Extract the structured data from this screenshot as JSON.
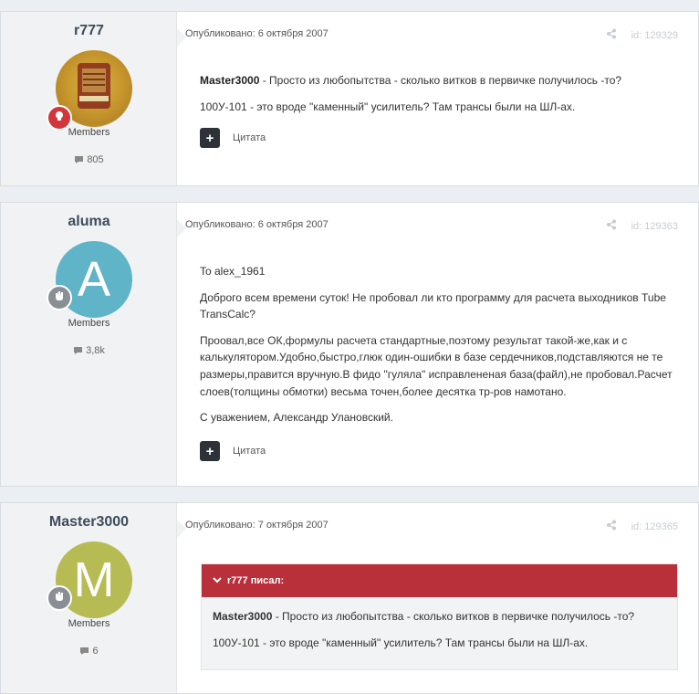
{
  "posts": [
    {
      "author": "r777",
      "group": "Members",
      "count": "805",
      "meta": "Опубликовано: 6 октября 2007",
      "id": "id: 129329",
      "content_bold": "Master3000",
      "content_rest": " - Просто из любопытства - сколько витков в первичке получилось -то?",
      "content_line2": "100У-101 - это вроде \"каменный\" усилитель? Там трансы были на ШЛ-ах.",
      "quote_label": "Цитата"
    },
    {
      "author": "aluma",
      "avatar_letter": "A",
      "group": "Members",
      "count": "3,8k",
      "meta": "Опубликовано: 6 октября 2007",
      "id": "id: 129363",
      "paragraphs": [
        "To alex_1961",
        "Доброго всем времени суток! Не пробовал ли кто программу для расчета выходников Tube TransCalc?",
        "Проовал,все ОК,формулы расчета стандартные,поэтому результат такой-же,как и с калькулятором.Удобно,быстро,глюк один-ошибки в базе сердечников,подставляются не те размеры,правится вручную.В фидо \"гуляла\" исправлененая база(файл),не пробовал.Расчет слоев(толщины обмотки) весьма точен,более десятка тр-ров намотано.",
        "С уважением, Александр Улановский."
      ],
      "quote_label": "Цитата"
    },
    {
      "author": "Master3000",
      "avatar_letter": "M",
      "group": "Members",
      "count": "6",
      "meta": "Опубликовано: 7 октября 2007",
      "id": "id: 129365",
      "quote_head": "r777 писал:",
      "quote_bold": "Master3000",
      "quote_rest": " - Просто из любопытства - сколько витков в первичке получилось -то?",
      "quote_line2": "100У-101 - это вроде \"каменный\" усилитель? Там трансы были на ШЛ-ах."
    }
  ],
  "colors": {
    "avatar_aluma": "#5fb4c8",
    "avatar_master": "#b6bb53",
    "quote_header": "#b9303a",
    "badge_red": "#d2363a",
    "badge_gray": "#8a8f95"
  },
  "icons": [
    "share-icon",
    "comment-icon",
    "plus-icon",
    "chevron-down-icon",
    "lightbulb-icon",
    "hand-icon"
  ]
}
